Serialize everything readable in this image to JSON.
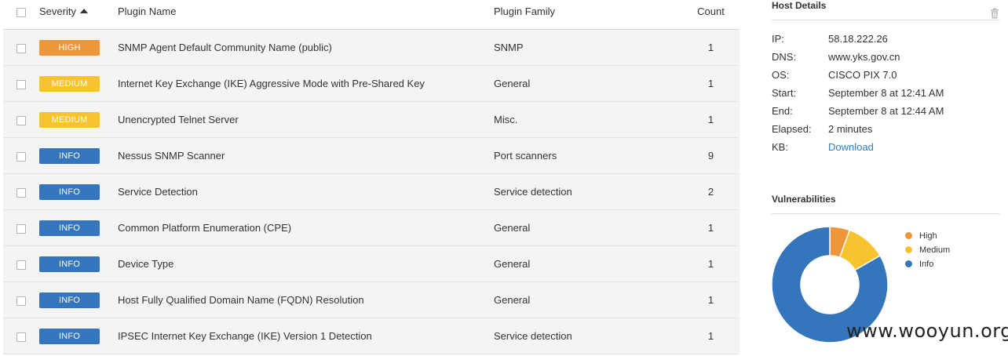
{
  "table": {
    "headers": {
      "severity": "Severity",
      "plugin_name": "Plugin Name",
      "plugin_family": "Plugin Family",
      "count": "Count"
    },
    "rows": [
      {
        "severity": "HIGH",
        "severity_color": "#f0963a",
        "name": "SNMP Agent Default Community Name (public)",
        "family": "SNMP",
        "count": "1"
      },
      {
        "severity": "MEDIUM",
        "severity_color": "#f7c32f",
        "name": "Internet Key Exchange (IKE) Aggressive Mode with Pre-Shared Key",
        "family": "General",
        "count": "1"
      },
      {
        "severity": "MEDIUM",
        "severity_color": "#f7c32f",
        "name": "Unencrypted Telnet Server",
        "family": "Misc.",
        "count": "1"
      },
      {
        "severity": "INFO",
        "severity_color": "#3475bb",
        "name": "Nessus SNMP Scanner",
        "family": "Port scanners",
        "count": "9"
      },
      {
        "severity": "INFO",
        "severity_color": "#3475bb",
        "name": "Service Detection",
        "family": "Service detection",
        "count": "2"
      },
      {
        "severity": "INFO",
        "severity_color": "#3475bb",
        "name": "Common Platform Enumeration (CPE)",
        "family": "General",
        "count": "1"
      },
      {
        "severity": "INFO",
        "severity_color": "#3475bb",
        "name": "Device Type",
        "family": "General",
        "count": "1"
      },
      {
        "severity": "INFO",
        "severity_color": "#3475bb",
        "name": "Host Fully Qualified Domain Name (FQDN) Resolution",
        "family": "General",
        "count": "1"
      },
      {
        "severity": "INFO",
        "severity_color": "#3475bb",
        "name": "IPSEC Internet Key Exchange (IKE) Version 1 Detection",
        "family": "Service detection",
        "count": "1"
      }
    ]
  },
  "host_details": {
    "title": "Host Details",
    "fields": [
      {
        "label": "IP:",
        "value": "58.18.222.26"
      },
      {
        "label": "DNS:",
        "value": "www.yks.gov.cn"
      },
      {
        "label": "OS:",
        "value": "CISCO PIX 7.0"
      },
      {
        "label": "Start:",
        "value": "September 8 at 12:41 AM"
      },
      {
        "label": "End:",
        "value": "September 8 at 12:44 AM"
      },
      {
        "label": "Elapsed:",
        "value": "2 minutes"
      },
      {
        "label": "KB:",
        "value": "Download",
        "link": true
      }
    ],
    "trash_icon": "trash-icon"
  },
  "vulnerabilities": {
    "title": "Vulnerabilities",
    "legend": [
      {
        "label": "High",
        "color": "#f0963a"
      },
      {
        "label": "Medium",
        "color": "#f7c32f"
      },
      {
        "label": "Info",
        "color": "#3475bb"
      }
    ]
  },
  "chart_data": {
    "type": "pie",
    "categories": [
      "High",
      "Medium",
      "Info"
    ],
    "values": [
      1,
      2,
      15
    ],
    "colors": [
      "#f0963a",
      "#f7c32f",
      "#3475bb"
    ]
  },
  "watermark": "www.wooyun.org"
}
